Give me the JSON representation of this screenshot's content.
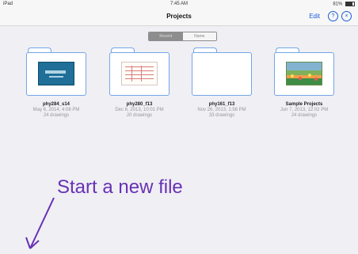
{
  "status_bar": {
    "left": "iPad",
    "time": "7:45 AM",
    "right": "81%"
  },
  "nav": {
    "title": "Projects",
    "edit_label": "Edit",
    "help_label": "?",
    "close_label": "×"
  },
  "segmented": {
    "items": [
      "Recent",
      "Name"
    ]
  },
  "projects": [
    {
      "name": "phy284_s14",
      "date": "May 6, 2014, 4:08 PM",
      "count": "24 drawings"
    },
    {
      "name": "phy280_f13",
      "date": "Dec 6, 2013, 10:01 PM",
      "count": "20 drawings"
    },
    {
      "name": "phy161_f13",
      "date": "Nov 26, 2013, 1:56 PM",
      "count": "33 drawings"
    },
    {
      "name": "Sample Projects",
      "date": "Jun 7, 2013, 12:02 PM",
      "count": "24 drawings"
    }
  ],
  "annotation": {
    "text": "Start a new file"
  },
  "colors": {
    "accent": "#1a5bd8",
    "annotation": "#6831b4",
    "folder_outline": "#73a6e8"
  }
}
